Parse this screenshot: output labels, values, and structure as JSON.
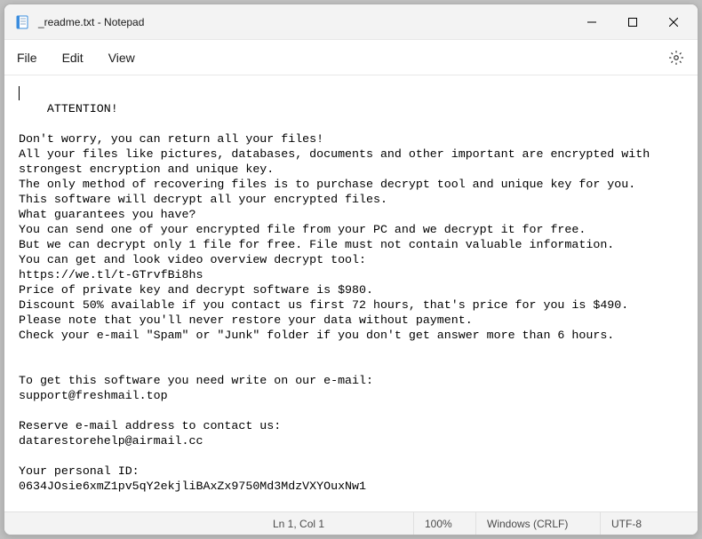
{
  "window": {
    "title": "_readme.txt - Notepad"
  },
  "menu": {
    "file": "File",
    "edit": "Edit",
    "view": "View"
  },
  "document": {
    "text": "ATTENTION!\n\nDon't worry, you can return all your files!\nAll your files like pictures, databases, documents and other important are encrypted with strongest encryption and unique key.\nThe only method of recovering files is to purchase decrypt tool and unique key for you.\nThis software will decrypt all your encrypted files.\nWhat guarantees you have?\nYou can send one of your encrypted file from your PC and we decrypt it for free.\nBut we can decrypt only 1 file for free. File must not contain valuable information.\nYou can get and look video overview decrypt tool:\nhttps://we.tl/t-GTrvfBi8hs\nPrice of private key and decrypt software is $980.\nDiscount 50% available if you contact us first 72 hours, that's price for you is $490.\nPlease note that you'll never restore your data without payment.\nCheck your e-mail \"Spam\" or \"Junk\" folder if you don't get answer more than 6 hours.\n\n\nTo get this software you need write on our e-mail:\nsupport@freshmail.top\n\nReserve e-mail address to contact us:\ndatarestorehelp@airmail.cc\n\nYour personal ID:\n0634JOsie6xmZ1pv5qY2ekjliBAxZx9750Md3MdzVXYOuxNw1"
  },
  "status": {
    "position": "Ln 1, Col 1",
    "zoom": "100%",
    "lineEnding": "Windows (CRLF)",
    "encoding": "UTF-8"
  }
}
